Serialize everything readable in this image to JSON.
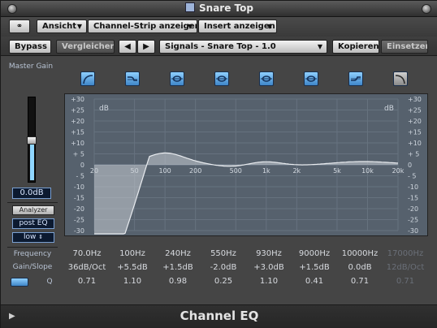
{
  "window": {
    "title": "Snare Top"
  },
  "toolbar": {
    "link_label": "⚭",
    "view_label": "Ansicht",
    "channel_strip_label": "Channel-Strip anzeigen",
    "insert_label": "Insert anzeigen",
    "bypass_label": "Bypass",
    "compare_label": "Vergleichen",
    "prev_label": "◀",
    "next_label": "▶",
    "preset_label": "Signals - Snare Top - 1.0",
    "copy_label": "Kopieren",
    "paste_label": "Einsetzen"
  },
  "left": {
    "master_gain_label": "Master Gain",
    "master_gain_value": "0.0dB",
    "master_gain_level": 0.5,
    "analyzer_label": "Analyzer",
    "post_eq_label": "post EQ",
    "low_label": "low"
  },
  "bands": [
    {
      "icon": "low-cut-icon",
      "active": true
    },
    {
      "icon": "low-shelf-icon",
      "active": true
    },
    {
      "icon": "bell-icon",
      "active": true
    },
    {
      "icon": "bell-icon",
      "active": true
    },
    {
      "icon": "bell-icon",
      "active": true
    },
    {
      "icon": "bell-icon",
      "active": true
    },
    {
      "icon": "high-shelf-icon",
      "active": true
    },
    {
      "icon": "high-cut-icon",
      "active": false
    }
  ],
  "graph": {
    "db_label": "dB",
    "db_ticks": [
      "+30",
      "+25",
      "+20",
      "+15",
      "+10",
      "+ 5",
      "0",
      "- 5",
      "-10",
      "-15",
      "-20",
      "-25",
      "-30"
    ],
    "freq_ticks": [
      "20",
      "50",
      "100",
      "200",
      "500",
      "1k",
      "2k",
      "5k",
      "10k",
      "20k"
    ]
  },
  "params": {
    "frequency_label": "Frequency",
    "gainslope_label": "Gain/Slope",
    "q_label": "Q",
    "frequency": [
      "70.0Hz",
      "100Hz",
      "240Hz",
      "550Hz",
      "930Hz",
      "9000Hz",
      "10000Hz",
      "17000Hz"
    ],
    "gain": [
      "36dB/Oct",
      "+5.5dB",
      "+1.5dB",
      "-2.0dB",
      "+3.0dB",
      "+1.5dB",
      "0.0dB",
      "12dB/Oct"
    ],
    "q": [
      "0.71",
      "1.10",
      "0.98",
      "0.25",
      "1.10",
      "0.41",
      "0.71",
      "0.71"
    ]
  },
  "footer": {
    "plugin_name": "Channel EQ",
    "disclosure": "▶"
  }
}
